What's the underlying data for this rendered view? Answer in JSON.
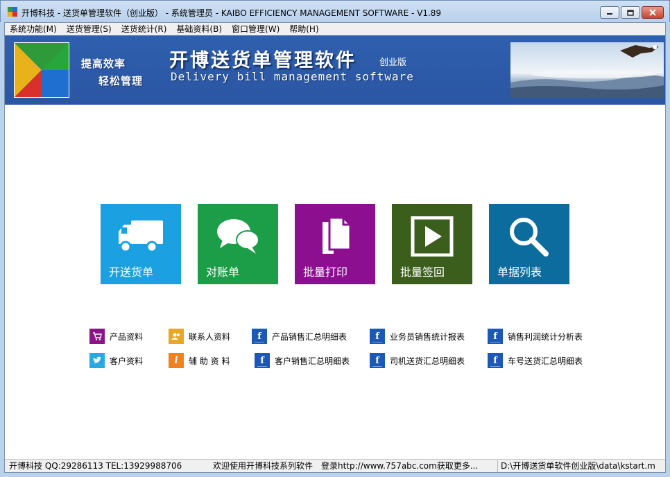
{
  "window": {
    "title": "开博科技 - 送货单管理软件（创业版） - 系统管理员 - KAIBO EFFICIENCY MANAGEMENT SOFTWARE - V1.89"
  },
  "menu": [
    "系统功能(M)",
    "送货管理(S)",
    "送货统计(R)",
    "基础资料(B)",
    "窗口管理(W)",
    "帮助(H)"
  ],
  "banner": {
    "slogan_line1": "提高效率",
    "slogan_line2": "轻松管理",
    "title": "开博送货单管理软件",
    "edition": "创业版",
    "subtitle": "Delivery bill management software"
  },
  "tiles": [
    {
      "label": "开送货单",
      "color": "#1ba1e2",
      "icon": "truck-icon"
    },
    {
      "label": "对账单",
      "color": "#1c9e48",
      "icon": "chat-bubbles-icon"
    },
    {
      "label": "批量打印",
      "color": "#8b0f8f",
      "icon": "documents-icon"
    },
    {
      "label": "批量签回",
      "color": "#3b5e1c",
      "icon": "play-icon"
    },
    {
      "label": "单据列表",
      "color": "#0b6c9d",
      "icon": "search-icon"
    }
  ],
  "links_row1": [
    {
      "label": "产品资料",
      "icon": "cart-icon",
      "color": "#8b1489"
    },
    {
      "label": "联系人资料",
      "icon": "contacts-icon",
      "color": "#e9a727"
    },
    {
      "label": "产品销售汇总明细表",
      "icon": "facebook-icon",
      "color": "#1c58b5"
    },
    {
      "label": "业务员销售统计报表",
      "icon": "facebook-icon",
      "color": "#1c58b5"
    },
    {
      "label": "销售利润统计分析表",
      "icon": "facebook-icon",
      "color": "#1c58b5"
    }
  ],
  "links_row2": [
    {
      "label": "客户资料",
      "icon": "twitter-icon",
      "color": "#2aa9e0"
    },
    {
      "label": "辅 助 资 料",
      "icon": "info-icon",
      "color": "#f0821e"
    },
    {
      "label": "客户销售汇总明细表",
      "icon": "facebook-icon",
      "color": "#1c58b5"
    },
    {
      "label": "司机送货汇总明细表",
      "icon": "facebook-icon",
      "color": "#1c58b5"
    },
    {
      "label": "车号送货汇总明细表",
      "icon": "facebook-icon",
      "color": "#1c58b5"
    }
  ],
  "status": {
    "contact": "开博科技 QQ:29286113 TEL:13929988706",
    "welcome": "欢迎使用开博科技系列软件",
    "website": "登录http://www.757abc.com获取更多...",
    "path": "D:\\开博送货单软件创业版\\data\\kstart.m"
  }
}
